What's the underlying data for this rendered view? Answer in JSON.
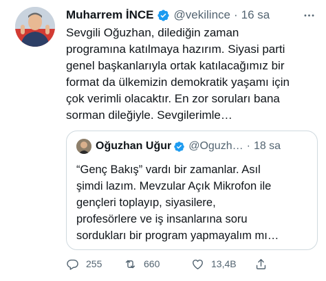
{
  "tweet": {
    "author": {
      "display_name": "Muharrem İNCE",
      "handle": "@vekilince",
      "verified": true,
      "avatar_icon": "profile-photo"
    },
    "separator": "·",
    "time": "16 sa",
    "text": "Sevgili Oğuzhan, dilediğin zaman\nprogramına katılmaya hazırım. Siyasi parti\ngenel başkanlarıyla ortak katılacağımız bir\nformat da ülkemizin demokratik yaşamı için\nçok verimli olacaktır. En zor soruları bana\nsorman dileğiyle. Sevgilerimle…",
    "quoted": {
      "display_name": "Oğuzhan Uğur",
      "handle": "@Oguzh…",
      "verified": true,
      "separator": "·",
      "time": "18 sa",
      "text": "“Genç Bakış” vardı bir zamanlar. Asıl\nşimdi lazım. Mevzular Açık Mikrofon ile\ngençleri toplayıp, siyasilere,\nprofesörlere ve iş insanlarına soru\nsordukları bir program yapmayalım mı…"
    },
    "actions": {
      "reply_count": "255",
      "retweet_count": "660",
      "like_count": "13,4B"
    }
  },
  "colors": {
    "verified_blue": "#1d9bf0",
    "text_primary": "#0f1419",
    "text_secondary": "#536471",
    "border": "#cfd9de"
  }
}
